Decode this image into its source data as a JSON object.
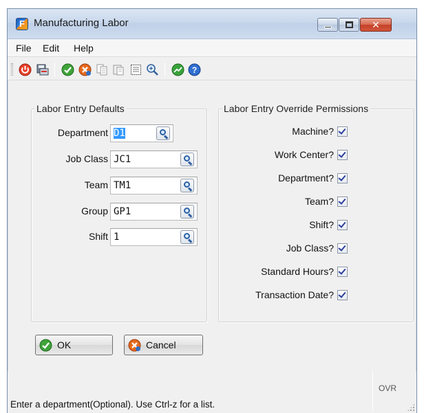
{
  "window": {
    "title": "Manufacturing Labor",
    "app_icon_letter": "F",
    "controls": {
      "minimize": "minimize",
      "maximize": "maximize",
      "close": "✕"
    }
  },
  "menu": {
    "items": [
      {
        "label": "File"
      },
      {
        "label": "Edit"
      },
      {
        "label": "Help"
      }
    ]
  },
  "toolbar": {
    "icons": [
      "power-exit-icon",
      "save-print-icon",
      "accept-check-icon",
      "cancel-x-icon",
      "copy-page-icon",
      "paste-page-icon",
      "select-all-icon",
      "lookup-zoom-icon",
      "chart-icon",
      "help-icon"
    ]
  },
  "defaults_group": {
    "legend": "Labor Entry Defaults",
    "fields": [
      {
        "label": "Department",
        "value": "D1",
        "selected": true
      },
      {
        "label": "Job Class",
        "value": "JC1"
      },
      {
        "label": "Team",
        "value": "TM1"
      },
      {
        "label": "Group",
        "value": "GP1"
      },
      {
        "label": "Shift",
        "value": "1"
      }
    ]
  },
  "permissions_group": {
    "legend": "Labor Entry Override Permissions",
    "items": [
      {
        "label": "Machine?",
        "checked": true
      },
      {
        "label": "Work Center?",
        "checked": true
      },
      {
        "label": "Department?",
        "checked": true
      },
      {
        "label": "Team?",
        "checked": true
      },
      {
        "label": "Shift?",
        "checked": true
      },
      {
        "label": "Job Class?",
        "checked": true
      },
      {
        "label": "Standard Hours?",
        "checked": true
      },
      {
        "label": "Transaction Date?",
        "checked": true
      }
    ]
  },
  "buttons": {
    "ok": "OK",
    "cancel": "Cancel"
  },
  "status": {
    "message": "Enter a department(Optional).  Use Ctrl-z for a list.",
    "mode": "OVR"
  },
  "colors": {
    "accent_selection": "#3399ff",
    "close_button": "#c4412a",
    "checkmark": "#2a3d9c"
  }
}
